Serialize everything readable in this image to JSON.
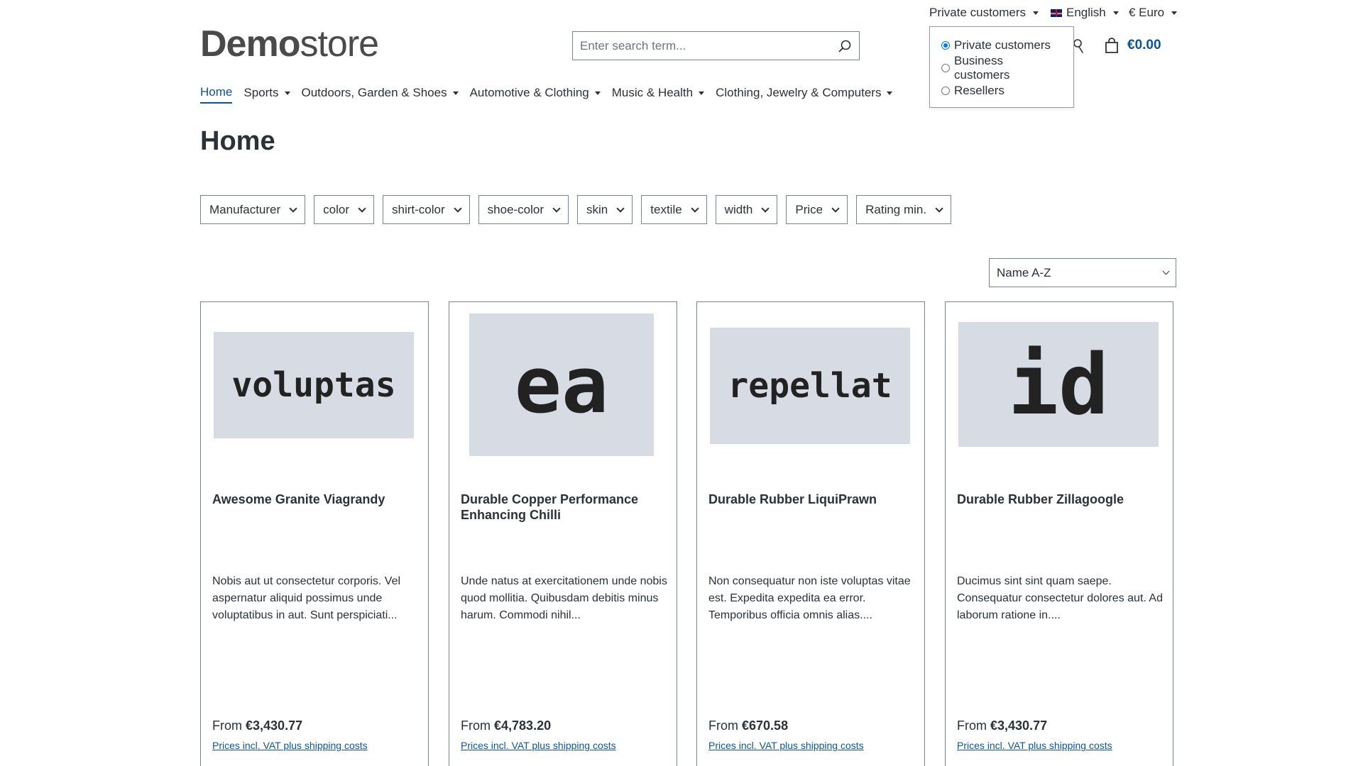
{
  "topbar": {
    "customer_group": "Private customers",
    "language": "English",
    "currency": "€ Euro"
  },
  "customer_dropdown": {
    "options": [
      {
        "label": "Private customers",
        "checked": true
      },
      {
        "label": "Business customers",
        "checked": false
      },
      {
        "label": "Resellers",
        "checked": false
      }
    ]
  },
  "header": {
    "logo_bold": "Demo",
    "logo_light": "store",
    "search_placeholder": "Enter search term...",
    "cart_total": "€0.00"
  },
  "nav": {
    "items": [
      {
        "label": "Home",
        "active": true
      },
      {
        "label": "Sports"
      },
      {
        "label": "Outdoors, Garden & Shoes"
      },
      {
        "label": "Automotive & Clothing"
      },
      {
        "label": "Music & Health"
      },
      {
        "label": "Clothing, Jewelry & Computers"
      }
    ]
  },
  "page": {
    "title": "Home"
  },
  "filters": [
    "Manufacturer",
    "color",
    "shirt-color",
    "shoe-color",
    "skin",
    "textile",
    "width",
    "Price",
    "Rating min."
  ],
  "sort": {
    "selected": "Name A-Z"
  },
  "products": [
    {
      "image_text": "voluptas",
      "name": "Awesome Granite Viagrandy",
      "description": "Nobis aut ut consectetur corporis. Vel aspernatur aliquid possimus unde voluptatibus in aut. Sunt perspiciati...",
      "price_prefix": "From",
      "price": "€3,430.77",
      "vat_note": "Prices incl. VAT plus shipping costs"
    },
    {
      "image_text": "ea",
      "name": "Durable Copper Performance Enhancing Chilli",
      "description": "Unde natus at exercitationem unde nobis quod mollitia. Quibusdam debitis minus harum. Commodi nihil...",
      "price_prefix": "From",
      "price": "€4,783.20",
      "vat_note": "Prices incl. VAT plus shipping costs"
    },
    {
      "image_text": "repellat",
      "name": "Durable Rubber LiquiPrawn",
      "description": "Non consequatur non iste voluptas vitae est. Expedita expedita ea error. Temporibus officia omnis alias....",
      "price_prefix": "From",
      "price": "€670.58",
      "vat_note": "Prices incl. VAT plus shipping costs"
    },
    {
      "image_text": "id",
      "name": "Durable Rubber Zillagoogle",
      "description": "Ducimus sint sint quam saepe. Consequatur consectetur dolores aut. Ad laborum ratione in....",
      "price_prefix": "From",
      "price": "€3,430.77",
      "vat_note": "Prices incl. VAT plus shipping costs"
    }
  ],
  "colors": {
    "accent": "#0b539b",
    "text": "#2b3136",
    "border": "#798490",
    "image_bg": "#d6dbe4"
  }
}
